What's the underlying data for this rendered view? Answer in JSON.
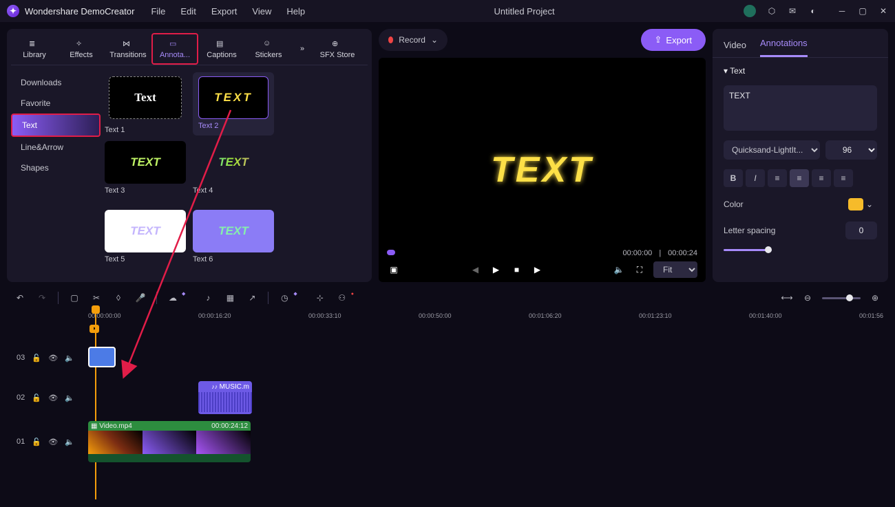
{
  "app": {
    "title": "Wondershare DemoCreator",
    "project": "Untitled Project"
  },
  "menu": {
    "file": "File",
    "edit": "Edit",
    "export": "Export",
    "view": "View",
    "help": "Help"
  },
  "topright": {
    "export": "Export",
    "record": "Record"
  },
  "tabs": {
    "library": "Library",
    "effects": "Effects",
    "transitions": "Transitions",
    "annotations": "Annota...",
    "captions": "Captions",
    "stickers": "Stickers",
    "sfxstore": "SFX Store"
  },
  "categories": {
    "downloads": "Downloads",
    "favorite": "Favorite",
    "text": "Text",
    "linearrow": "Line&Arrow",
    "shapes": "Shapes"
  },
  "thumbs": {
    "t1": "Text 1",
    "t2": "Text 2",
    "t3": "Text 3",
    "t4": "Text 4",
    "t5": "Text 5",
    "t6": "Text 6"
  },
  "preview": {
    "text": "TEXT",
    "time_cur": "00:00:00",
    "time_tot": "00:00:24",
    "fit": "Fit"
  },
  "rtabs": {
    "video": "Video",
    "annotations": "Annotations"
  },
  "props": {
    "section": "Text",
    "value": "TEXT",
    "font": "Quicksand-LightIt...",
    "size": "96",
    "color_label": "Color",
    "color_hex": "#f6bb2a",
    "spacing_label": "Letter spacing",
    "spacing_val": "0"
  },
  "ruler": {
    "m0": "00:00:00:00",
    "m1": "00:00:16:20",
    "m2": "00:00:33:10",
    "m3": "00:00:50:00",
    "m4": "00:01:06:20",
    "m5": "00:01:23:10",
    "m6": "00:01:40:00",
    "m7": "00:01:56"
  },
  "tracks": {
    "n3": "03",
    "n2": "02",
    "n1": "01"
  },
  "clips": {
    "audio": "MUSIC.m",
    "video": "Video.mp4",
    "video_end": "00:00:24:12"
  }
}
